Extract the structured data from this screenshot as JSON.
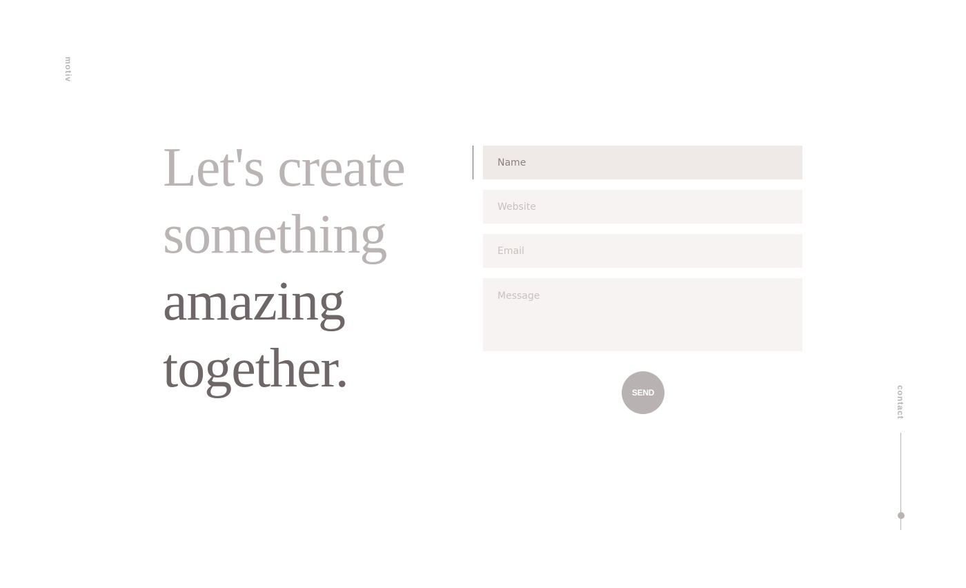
{
  "brand": {
    "logo_text": "motiv"
  },
  "headline": {
    "line1": "Let's create",
    "line2": "something",
    "line3": "amazing",
    "line4": "together."
  },
  "form": {
    "name_placeholder": "Name",
    "website_placeholder": "Website",
    "email_placeholder": "Email",
    "message_placeholder": "Message",
    "send_label": "SEND"
  },
  "side_nav": {
    "label": "contact"
  },
  "colors": {
    "light_text": "#bab4b4",
    "dark_text": "#6f6767",
    "field_background": "#f7f3f2",
    "active_field_background": "#efe9e7",
    "button": "#b8b2b2"
  }
}
